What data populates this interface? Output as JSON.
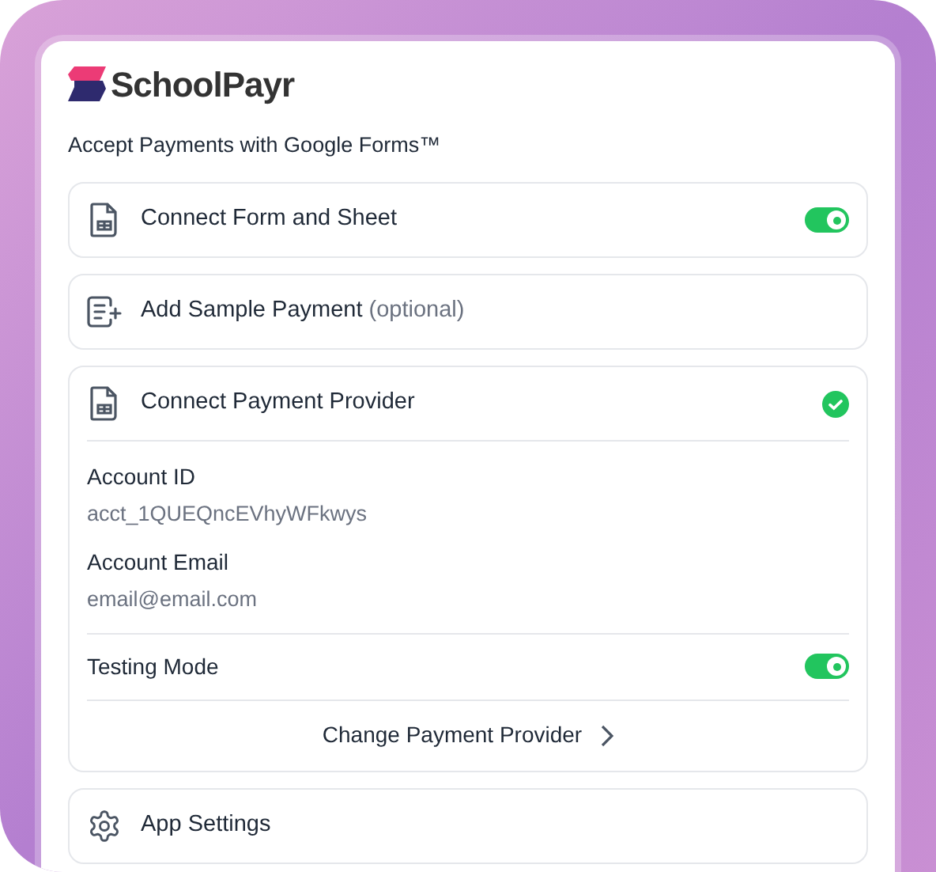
{
  "brand": {
    "name": "SchoolPayr"
  },
  "tagline": "Accept Payments with Google Forms™",
  "steps": [
    {
      "kind": "toggle",
      "title": "Connect Form and Sheet",
      "on": true
    },
    {
      "kind": "optional",
      "title": "Add Sample Payment",
      "note": "(optional)"
    },
    {
      "kind": "provider",
      "title": "Connect Payment Provider",
      "done": true,
      "fields": [
        {
          "label": "Account ID",
          "value": "acct_1QUEQncEVhyWFkwys"
        },
        {
          "label": "Account Email",
          "value": "email@email.com"
        }
      ],
      "testing": {
        "label": "Testing Mode",
        "on": true
      },
      "link": "Change Payment Provider"
    },
    {
      "kind": "settings",
      "title": "App Settings"
    }
  ]
}
